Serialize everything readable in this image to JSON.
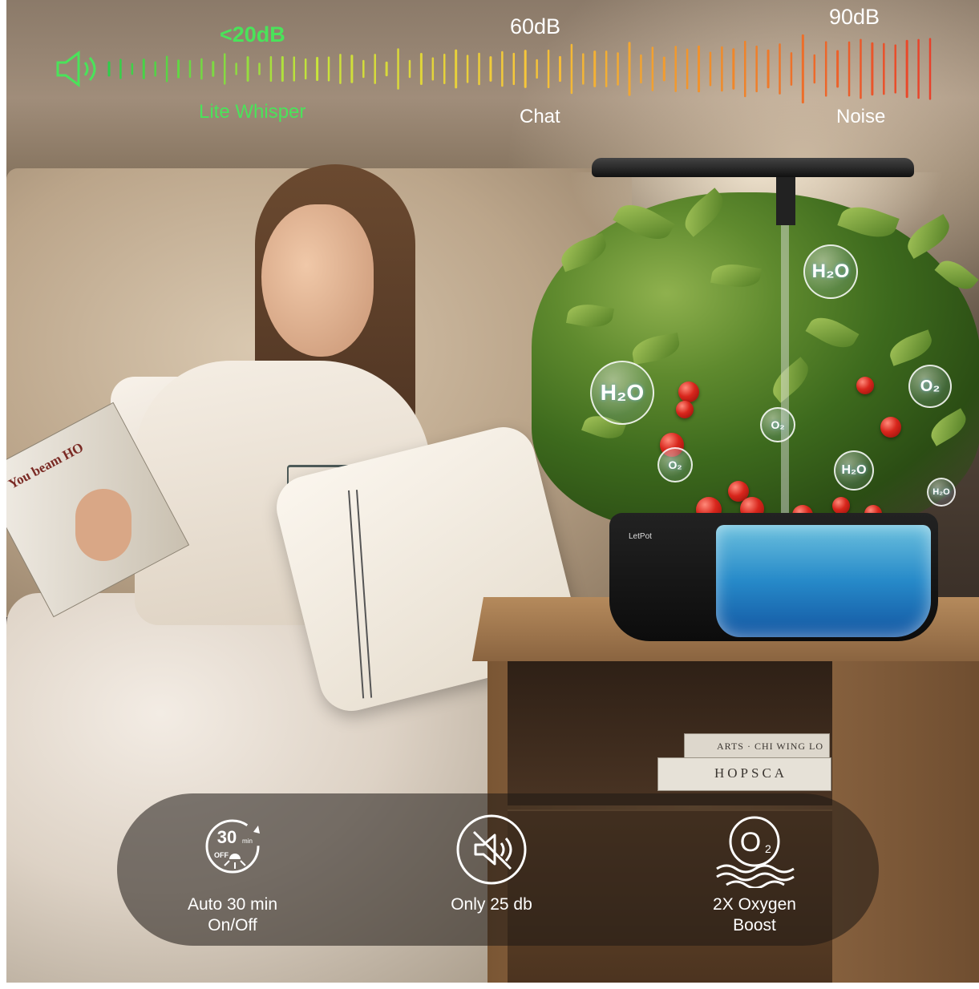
{
  "sound_scale": {
    "markers": [
      {
        "value": "<20dB",
        "caption": "Lite Whisper",
        "color": "#4ae35a"
      },
      {
        "value": "60dB",
        "caption": "Chat",
        "color": "#ffffff"
      },
      {
        "value": "90dB",
        "caption": "Noise",
        "color": "#ffffff"
      }
    ],
    "icon": "speaker-icon",
    "gradient": [
      "#2ecf4a",
      "#c8e43a",
      "#f6c83a",
      "#f08a2a",
      "#e8402a"
    ]
  },
  "product": {
    "brand": "LetPot",
    "bubbles": [
      "H₂O",
      "H₂O",
      "O₂",
      "O₂",
      "O₂",
      "H₂O",
      "H₂O"
    ]
  },
  "scene": {
    "magazine_text": "You beam HO",
    "book_1": "ARTS · CHI WING LO",
    "book_2": "HOPSCA"
  },
  "features": [
    {
      "icon": "timer-30min-icon",
      "label_line1": "Auto 30 min",
      "label_line2": "On/Off",
      "icon_text": "30",
      "icon_unit": "min",
      "icon_off": "OFF"
    },
    {
      "icon": "mute-speaker-icon",
      "label_line1": "Only 25 db",
      "label_line2": ""
    },
    {
      "icon": "oxygen-icon",
      "label_line1": "2X Oxygen",
      "label_line2": "Boost",
      "icon_text": "O",
      "icon_sub": "2"
    }
  ]
}
